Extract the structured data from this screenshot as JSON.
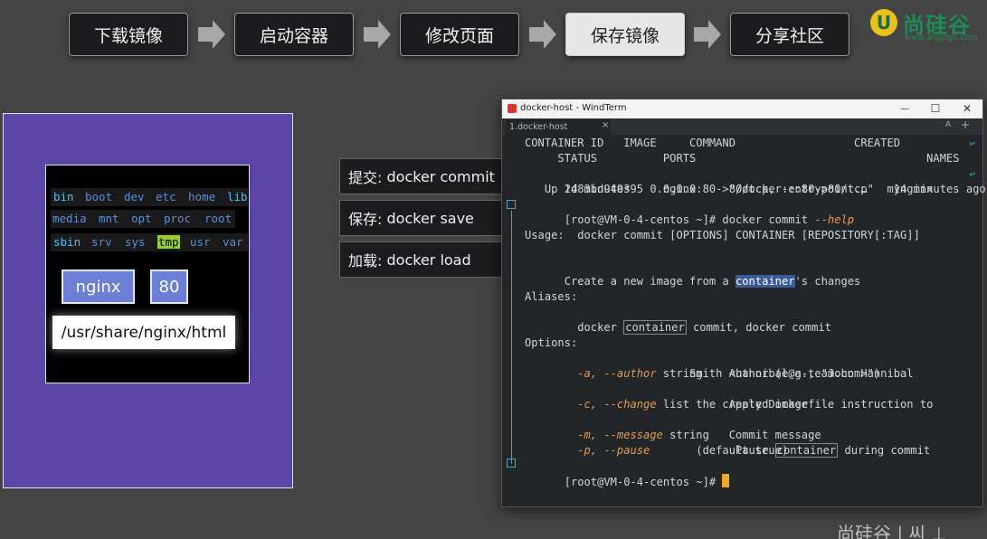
{
  "steps": [
    {
      "label": "下载镜像"
    },
    {
      "label": "启动容器"
    },
    {
      "label": "修改页面"
    },
    {
      "label": "保存镜像"
    },
    {
      "label": "分享社区"
    }
  ],
  "logo": {
    "mark": "U",
    "name": "尚硅谷",
    "url": "www.atguigu.com"
  },
  "illustration": {
    "dirs_row1": [
      "bin",
      "boot",
      "dev",
      "etc",
      "home",
      "lib"
    ],
    "dirs_row2": [
      "media",
      "mnt",
      "opt",
      "proc",
      "root"
    ],
    "dirs_row3": [
      "sbin",
      "srv",
      "sys",
      "tmp",
      "usr",
      "var"
    ],
    "name_box": "nginx",
    "port_box": "80",
    "path_box": "/usr/share/nginx/html"
  },
  "commands": [
    {
      "label": "提交:",
      "cmd": "docker commit"
    },
    {
      "label": "保存:",
      "cmd": "docker save"
    },
    {
      "label": "加载:",
      "cmd": "docker load"
    }
  ],
  "window": {
    "title": "docker-host - WindTerm",
    "tab": "1.docker-host",
    "tab_close": "×",
    "tabbar_right": [
      "A",
      "+"
    ],
    "minimize": "—",
    "maximize": "☐",
    "close": "✕"
  },
  "terminal": {
    "hdr1": "CONTAINER ID   IMAGE     COMMAND                  CREATED",
    "hdr2": "     STATUS          PORTS                                   NAMES",
    "row1": "2d83bd949395   nginx     \"/docker-entrypoint.…\"   14 minutes ago",
    "row2_a": "   Up 14 minutes   0.0.0.0:80->80/tcp, :::80->80/tcp   mynginx",
    "prompt1": "[root@VM-0-4-centos ~]# docker commit ",
    "prompt1_opt": "--help",
    "usage": "Usage:  docker commit [OPTIONS] CONTAINER [REPOSITORY[:TAG]]",
    "desc_a": "Create a new image from a ",
    "desc_hl": "container",
    "desc_b": "'s changes",
    "aliases": "Aliases:",
    "alias_a": "  docker ",
    "alias_hl": "container",
    "alias_b": " commit, docker commit",
    "options": "Options:",
    "o1_flag": "  -a, --author",
    "o1_type": " string    ",
    "o1_desc": "Author (e.g., \"John Hannibal",
    "o1_desc2": "                         Smith <hannibal@a-team.com>\")",
    "o2_flag": "  -c, --change",
    "o2_type": " list      ",
    "o2_desc": "Apply Dockerfile instruction to",
    "o2_desc2": "                          the created image",
    "o3_flag": "  -m, --message",
    "o3_type": " string   ",
    "o3_desc": "Commit message",
    "o4_flag": "  -p, --pause",
    "o4_type": "             ",
    "o4_desc_a": "Pause ",
    "o4_hl": "container",
    "o4_desc_b": " during commit",
    "o4_desc2": "                          (default true)",
    "prompt2": "[root@VM-0-4-centos ~]# "
  },
  "watermark": "尚硅谷 | 씨 ⊥"
}
